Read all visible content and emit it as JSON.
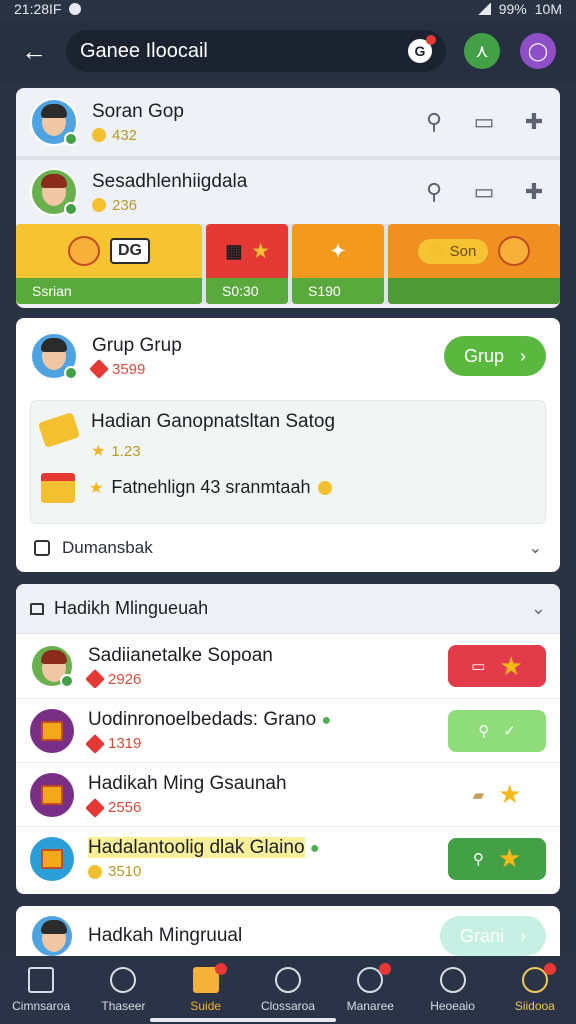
{
  "status_bar": {
    "time": "21:28IF",
    "battery": "99%",
    "network": "10M"
  },
  "top_bar": {
    "back_icon": "←",
    "title": "Ganee Iloocail",
    "pill_icon": "G"
  },
  "card_players": {
    "rows": [
      {
        "name": "Soran Gop",
        "value": "432"
      },
      {
        "name": "Sesadhlenhiigdala",
        "value": "236"
      }
    ],
    "tiles": [
      {
        "badge": "DG",
        "label": "Ssrian"
      },
      {
        "label": "S0:30"
      },
      {
        "label": "S190"
      },
      {
        "pill": "Son"
      }
    ]
  },
  "card_group": {
    "name": "Grup Grup",
    "value": "3599",
    "button": "Grup",
    "reward_title": "Hadian Ganopnatsltan Satog",
    "reward_value": "1.23",
    "reward_line": "Fatnehlign 43 sranmtaah",
    "footer": "Dumansbak"
  },
  "card_list": {
    "header": "Hadikh Mlingueuah",
    "items": [
      {
        "name": "Sadiianetalke Sopoan",
        "value": "2926",
        "action": "red"
      },
      {
        "name": "Uodinronoelbedads: Grano",
        "value": "1319",
        "action": "lime"
      },
      {
        "name": "Hadikah Ming Gsaunah",
        "value": "2556",
        "action": "plain"
      },
      {
        "name": "Hadalantoolig dlak Glaino",
        "value": "3510",
        "action": "green"
      }
    ]
  },
  "card_last": {
    "name": "Hadkah Mingruual",
    "button": "Grani"
  },
  "bottom_nav": [
    {
      "label": "Cimnsaroa"
    },
    {
      "label": "Thaseer"
    },
    {
      "label": "Suide"
    },
    {
      "label": "Clossaroa"
    },
    {
      "label": "Manaree"
    },
    {
      "label": "Heoeaio"
    },
    {
      "label": "Siidooa"
    }
  ],
  "colors": {
    "accent": "#5bb83f",
    "header": "#273040",
    "nav": "#2b3446",
    "active": "#f4b23a"
  }
}
